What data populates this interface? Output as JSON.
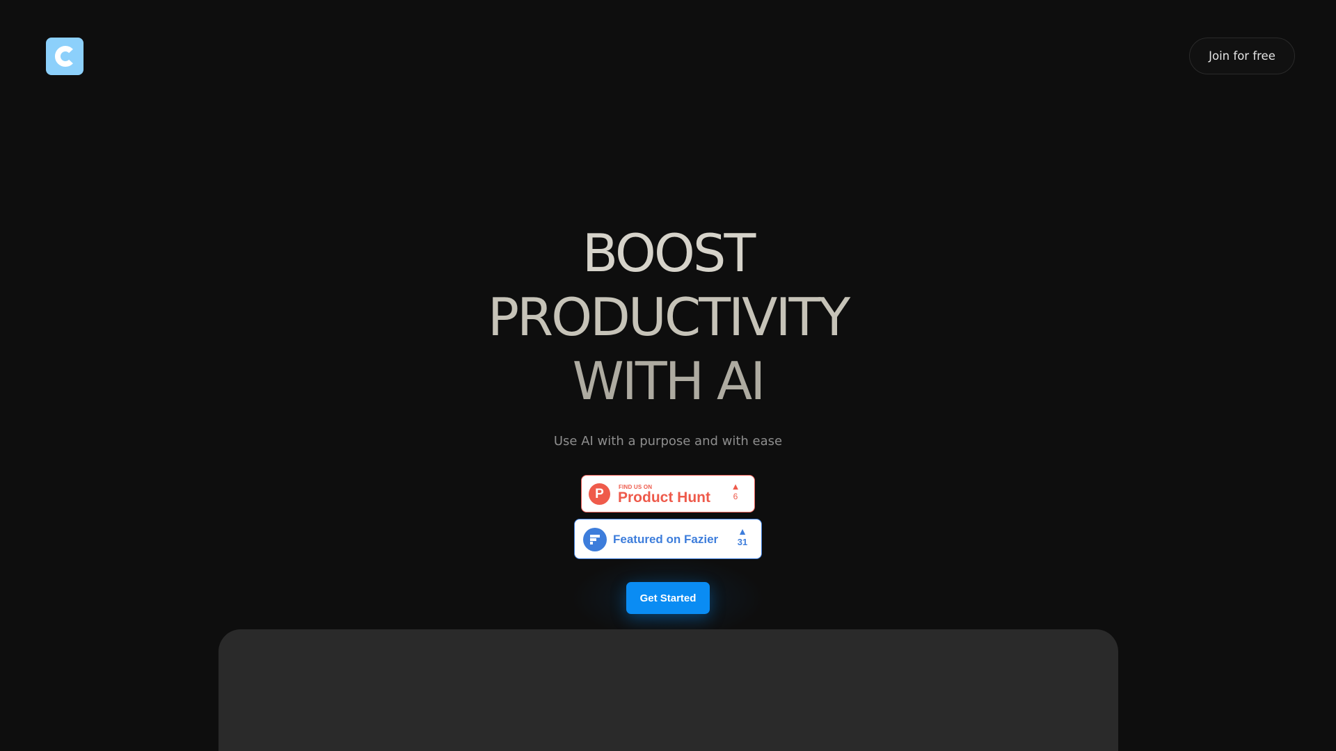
{
  "header": {
    "logo_icon": "c-logo-icon",
    "join_label": "Join for free"
  },
  "hero": {
    "title_line1": "BOOST",
    "title_line2": "PRODUCTIVITY",
    "title_line3": "WITH AI",
    "subtitle": "Use AI with a purpose and with ease"
  },
  "badges": {
    "product_hunt": {
      "small_label": "FIND US ON",
      "name": "Product Hunt",
      "logo_letter": "P",
      "vote_icon": "up-triangle-icon",
      "votes": "6",
      "color": "#ef5b4b"
    },
    "fazier": {
      "label": "Featured on Fazier",
      "vote_icon": "up-triangle-icon",
      "votes": "31",
      "color": "#3d7ddb"
    }
  },
  "cta": {
    "label": "Get Started",
    "color": "#0a8cf3"
  },
  "colors": {
    "background": "#0e0e0e",
    "logo_bg": "#8cd0fb",
    "preview_panel": "#2a2a2a"
  }
}
